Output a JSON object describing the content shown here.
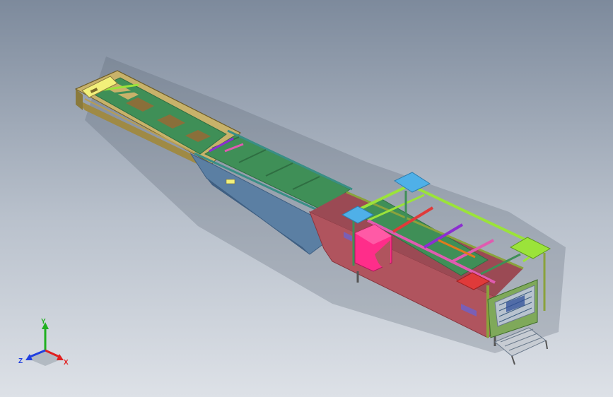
{
  "scene": {
    "background_top": "#7d8a9c",
    "background_mid": "#b9c1cc",
    "background_bottom": "#dde1e7",
    "colors": {
      "tan_frame": "#c8b26a",
      "tan_dark": "#9f8a45",
      "yellow_plate": "#f2f07a",
      "green_belt": "#3f8f57",
      "green_belt_dark": "#2f6e42",
      "blue_frame": "#5b7fa3",
      "blue_dark": "#3f5f82",
      "teal_rail": "#3a8e86",
      "red_body": "#b0545e",
      "red_dark": "#87363f",
      "pink_panel": "#ff2d8a",
      "lime": "#9be33a",
      "light_blue": "#4fb0e8",
      "purple": "#8c2fd1",
      "magenta_bar": "#e05bb0",
      "olive": "#8aa23c",
      "cyan": "#3fb6d6",
      "orange": "#e07a1c",
      "grey_cage": "#b8c3cf",
      "red_brace": "#e03a3a"
    }
  },
  "triad": {
    "x_label": "X",
    "y_label": "Y",
    "z_label": "Z",
    "x_color": "#e02020",
    "y_color": "#20b020",
    "z_color": "#2040e0"
  }
}
